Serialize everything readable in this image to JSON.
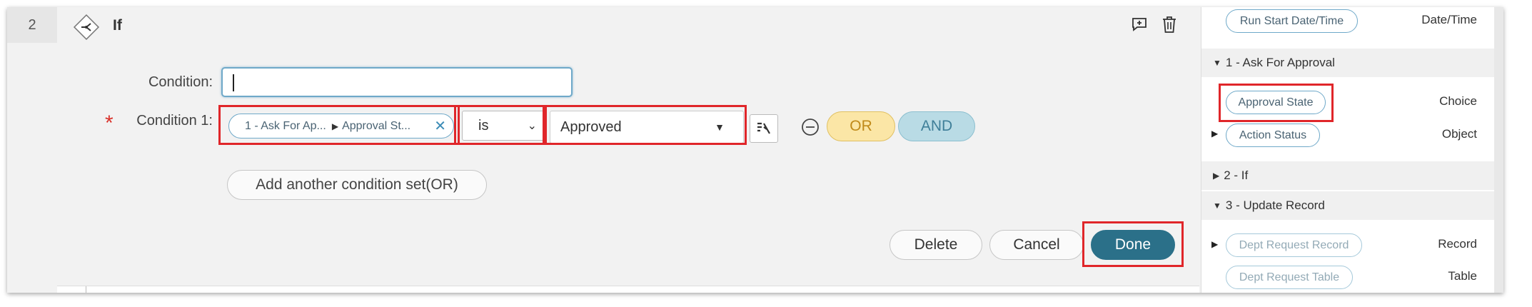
{
  "row": {
    "number": "2",
    "title": "If"
  },
  "icons": {
    "if_icon": "branch-diamond-icon",
    "comment_icon": "add-comment-icon",
    "trash_icon": "trash-icon"
  },
  "condition": {
    "label": "Condition:",
    "value": ""
  },
  "condition1": {
    "required_marker": "*",
    "label": "Condition 1:",
    "field_pill": {
      "step": "1 - Ask For Ap...",
      "field": "Approval St..."
    },
    "operator": "is",
    "value": "Approved"
  },
  "logic_buttons": {
    "or": "OR",
    "and": "AND"
  },
  "add_condition_set": "Add another condition set(OR)",
  "actions": {
    "delete": "Delete",
    "cancel": "Cancel",
    "done": "Done"
  },
  "right_panel": {
    "top_item": {
      "name": "Run Start Date/Time",
      "type": "Date/Time"
    },
    "sections": [
      {
        "title": "1 - Ask For Approval"
      },
      {
        "title": "2 - If"
      },
      {
        "title": "3 - Update Record"
      }
    ],
    "ask_items": [
      {
        "name": "Approval State",
        "type": "Choice"
      },
      {
        "name": "Action Status",
        "type": "Object"
      }
    ],
    "update_items": [
      {
        "name": "Dept Request Record",
        "type": "Record"
      },
      {
        "name": "Dept Request Table",
        "type": "Table"
      }
    ]
  },
  "colors": {
    "highlight": "#e0262a",
    "done_bg": "#2b7089",
    "or_bg": "#fbe6a6",
    "and_bg": "#b9dbe5",
    "pill_border": "#6fa9c9"
  }
}
